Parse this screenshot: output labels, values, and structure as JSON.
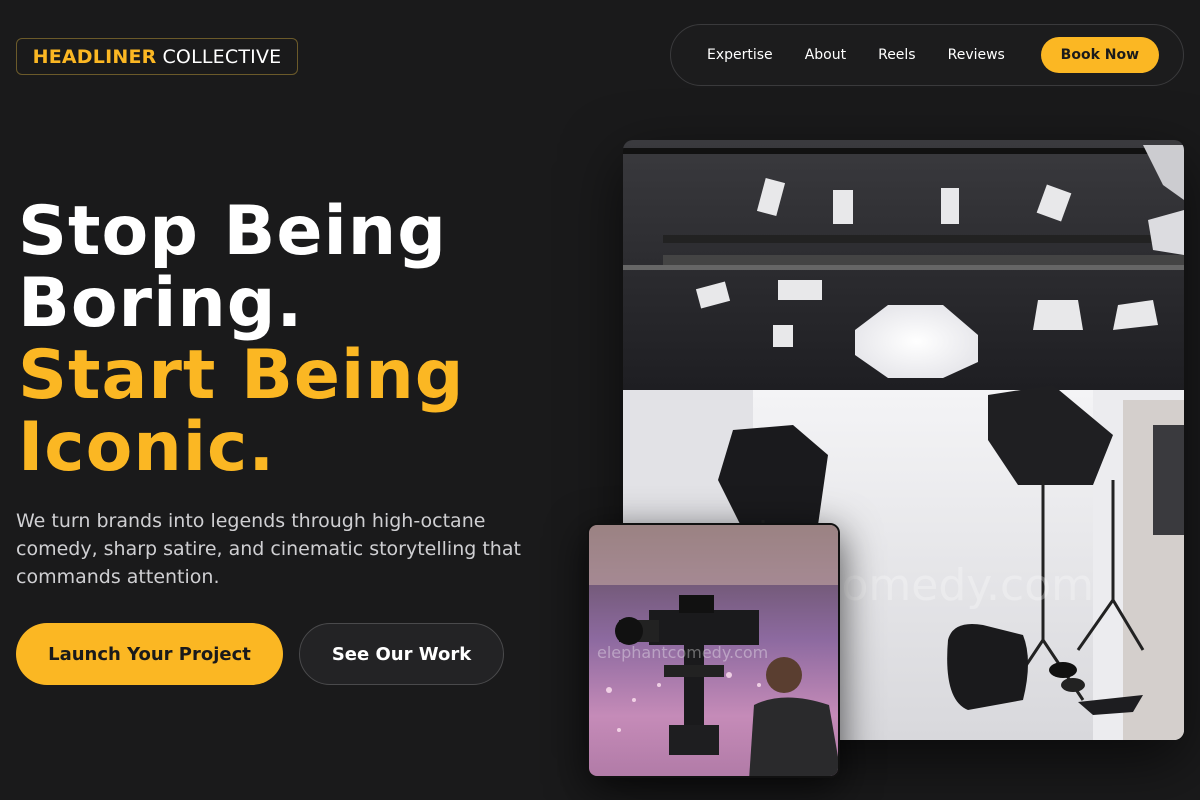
{
  "brand": {
    "accent_part": "HEADLINER",
    "plain_part": "COLLECTIVE",
    "accent_color": "#fbb723"
  },
  "nav": {
    "links": [
      "Expertise",
      "About",
      "Reels",
      "Reviews"
    ],
    "cta": "Book Now"
  },
  "hero": {
    "headline_line1": "Stop Being",
    "headline_line2": "Boring.",
    "headline_line3": "Start Being",
    "headline_line4": "Iconic.",
    "description": "We turn brands into legends through high-octane comedy, sharp satire, and cinematic storytelling that commands attention.",
    "primary_button": "Launch Your Project",
    "secondary_button": "See Our Work"
  },
  "images": {
    "studio_watermark": "elephantcomedy.com",
    "camera_watermark": "elephantcomedy.com"
  }
}
